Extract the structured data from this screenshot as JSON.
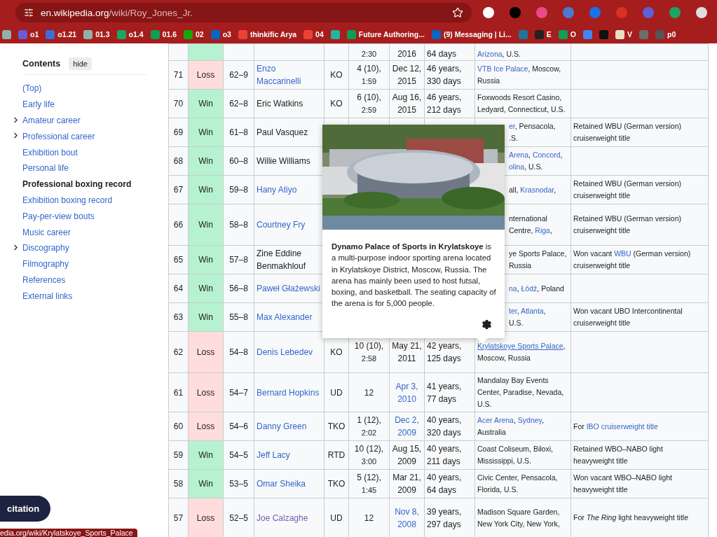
{
  "browser": {
    "url_host": "en.wikipedia.org",
    "url_path": "/wiki/Roy_Jones_Jr.",
    "bookmarks": [
      {
        "color": "#8fb3a8"
      },
      {
        "label": "o1",
        "color": "#6b5bd6"
      },
      {
        "label": "o1.21",
        "color": "#3a6fd8"
      },
      {
        "label": "01.3",
        "color": "#8fb3a8"
      },
      {
        "label": "o1.4",
        "color": "#1fa463"
      },
      {
        "label": "01.6",
        "color": "#0f9d58"
      },
      {
        "label": "02",
        "color": "#14a800"
      },
      {
        "label": "o3",
        "color": "#0a66c2"
      },
      {
        "label": "thinkific Arya",
        "color": "#ea4335"
      },
      {
        "label": "04",
        "color": "#ea4335"
      },
      {
        "color": "#27b3a0"
      },
      {
        "label": "Future Authoring...",
        "color": "#0f9d58"
      },
      {
        "label": "(9) Messaging | Li...",
        "color": "#0a66c2"
      },
      {
        "color": "#21759b"
      },
      {
        "label": "E",
        "color": "#222222"
      },
      {
        "label": "O",
        "color": "#0f9d58"
      },
      {
        "color": "#4285f4"
      },
      {
        "color": "#111111"
      },
      {
        "label": "V",
        "color": "#e8e0c0"
      },
      {
        "color": "#6d6d6d"
      },
      {
        "label": "p0",
        "color": "#555555"
      }
    ]
  },
  "contents": {
    "title": "Contents",
    "hide_button": "hide",
    "items": [
      {
        "label": "(Top)",
        "expandable": false,
        "selected": false
      },
      {
        "label": "Early life",
        "expandable": false,
        "selected": false
      },
      {
        "label": "Amateur career",
        "expandable": true,
        "selected": false
      },
      {
        "label": "Professional career",
        "expandable": true,
        "selected": false
      },
      {
        "label": "Exhibition bout",
        "expandable": false,
        "selected": false
      },
      {
        "label": "Personal life",
        "expandable": false,
        "selected": false
      },
      {
        "label": "Professional boxing record",
        "expandable": false,
        "selected": true
      },
      {
        "label": "Exhibition boxing record",
        "expandable": false,
        "selected": false
      },
      {
        "label": "Pay-per-view bouts",
        "expandable": false,
        "selected": false
      },
      {
        "label": "Music career",
        "expandable": false,
        "selected": false
      },
      {
        "label": "Discography",
        "expandable": true,
        "selected": false
      },
      {
        "label": "Filmography",
        "expandable": false,
        "selected": false
      },
      {
        "label": "References",
        "expandable": false,
        "selected": false
      },
      {
        "label": "External links",
        "expandable": false,
        "selected": false
      }
    ]
  },
  "table": {
    "rows": [
      {
        "result": {
          "kind": "win"
        },
        "round": {
          "time": "2:30"
        },
        "date": {
          "text": "2016",
          "kind": "text"
        },
        "age": "64 days",
        "location": [
          {
            "text": "Arizona",
            "kind": "link"
          },
          {
            "text": ", U.S.",
            "kind": "text"
          }
        ]
      },
      {
        "no": "71",
        "result": {
          "text": "Loss",
          "kind": "loss"
        },
        "record": "62–9",
        "opponent": {
          "text": "Enzo Maccarinelli",
          "kind": "link"
        },
        "type": "KO",
        "round": {
          "text": "4 (10),",
          "time": "1:59"
        },
        "date": {
          "text": "Dec 12, 2015",
          "kind": "text"
        },
        "age": "46 years, 330 days",
        "location": [
          {
            "text": "VTB Ice Palace",
            "kind": "link"
          },
          {
            "text": ", Moscow, Russia",
            "kind": "text"
          }
        ]
      },
      {
        "no": "70",
        "result": {
          "text": "Win",
          "kind": "win"
        },
        "record": "62–8",
        "opponent": {
          "text": "Eric Watkins",
          "kind": "text"
        },
        "type": "KO",
        "round": {
          "text": "6 (10),",
          "time": "2:59"
        },
        "date": {
          "text": "Aug 16, 2015",
          "kind": "text"
        },
        "age": "46 years, 212 days",
        "location": [
          {
            "text": "Foxwoods Resort Casino, Ledyard, Connecticut, U.S.",
            "kind": "text"
          }
        ]
      },
      {
        "no": "69",
        "result": {
          "text": "Win",
          "kind": "win"
        },
        "record": "61–8",
        "opponent": {
          "text": "Paul Vasquez",
          "kind": "text"
        },
        "location_fragments": [
          [
            {
              "text": "er",
              "kind": "link"
            },
            {
              "text": ", Pensacola,",
              "kind": "text"
            }
          ],
          [
            {
              "text": ".S.",
              "kind": "text"
            }
          ]
        ],
        "notes": [
          {
            "text": "Retained WBU (German version) cruiserweight title",
            "kind": "text"
          }
        ]
      },
      {
        "no": "68",
        "result": {
          "text": "Win",
          "kind": "win"
        },
        "record": "60–8",
        "opponent": {
          "text": "Willie Williams",
          "kind": "text"
        },
        "location_fragments": [
          [
            {
              "text": "Arena",
              "kind": "link"
            },
            {
              "text": ", ",
              "kind": "text"
            },
            {
              "text": "Concord",
              "kind": "link"
            },
            {
              "text": ",",
              "kind": "text"
            }
          ],
          [
            {
              "text": "olina",
              "kind": "link"
            },
            {
              "text": ", U.S.",
              "kind": "text"
            }
          ]
        ]
      },
      {
        "no": "67",
        "result": {
          "text": "Win",
          "kind": "win"
        },
        "record": "59–8",
        "opponent": {
          "text": "Hany Atiyo",
          "kind": "link"
        },
        "location_fragments": [
          [
            {
              "text": "all, ",
              "kind": "text"
            },
            {
              "text": "Krasnodar",
              "kind": "link"
            },
            {
              "text": ",",
              "kind": "text"
            }
          ]
        ],
        "notes": [
          {
            "text": "Retained WBU (German version) cruiserweight title",
            "kind": "text"
          }
        ]
      },
      {
        "no": "66",
        "result": {
          "text": "Win",
          "kind": "win"
        },
        "record": "58–8",
        "opponent": {
          "text": "Courtney Fry",
          "kind": "link"
        },
        "location_fragments": [
          [
            {
              "text": "nternational",
              "kind": "text"
            }
          ],
          [
            {
              "text": "Centre, ",
              "kind": "text"
            },
            {
              "text": "Riga",
              "kind": "link"
            },
            {
              "text": ",",
              "kind": "text"
            }
          ]
        ],
        "notes": [
          {
            "text": "Retained WBU (German version) cruiserweight title",
            "kind": "text"
          }
        ]
      },
      {
        "no": "65",
        "result": {
          "text": "Win",
          "kind": "win"
        },
        "record": "57–8",
        "opponent": {
          "text": "Zine Eddine Benmakhlouf",
          "kind": "text"
        },
        "location_fragments": [
          [
            {
              "text": "ye Sports Palace,",
              "kind": "text"
            }
          ],
          [
            {
              "text": "Russia",
              "kind": "text"
            }
          ]
        ],
        "notes": [
          {
            "text": "Won vacant ",
            "kind": "text"
          },
          {
            "text": "WBU",
            "kind": "link"
          },
          {
            "text": " (German version) cruiserweight title",
            "kind": "text"
          }
        ]
      },
      {
        "no": "64",
        "result": {
          "text": "Win",
          "kind": "win"
        },
        "record": "56–8",
        "opponent": {
          "text": "Paweł Głażewski",
          "kind": "link"
        },
        "location_fragments": [
          [
            {
              "text": "na",
              "kind": "link"
            },
            {
              "text": ", ",
              "kind": "text"
            },
            {
              "text": "Łódź",
              "kind": "link"
            },
            {
              "text": ", Poland",
              "kind": "text"
            }
          ]
        ]
      },
      {
        "no": "63",
        "result": {
          "text": "Win",
          "kind": "win"
        },
        "record": "55–8",
        "opponent": {
          "text": "Max Alexander",
          "kind": "link"
        },
        "location_fragments": [
          [
            {
              "text": "ter",
              "kind": "link"
            },
            {
              "text": ", ",
              "kind": "text"
            },
            {
              "text": "Atlanta",
              "kind": "link"
            },
            {
              "text": ",",
              "kind": "text"
            }
          ],
          [
            {
              "text": "U.S.",
              "kind": "text"
            }
          ]
        ],
        "notes": [
          {
            "text": "Won vacant UBO Intercontinental cruiserweight title",
            "kind": "text"
          }
        ]
      },
      {
        "no": "62",
        "result": {
          "text": "Loss",
          "kind": "loss"
        },
        "record": "54–8",
        "opponent": {
          "text": "Denis Lebedev",
          "kind": "link"
        },
        "type": "KO",
        "round": {
          "text": "10 (10),",
          "time": "2:58"
        },
        "date": {
          "text": "May 21, 2011",
          "kind": "text"
        },
        "age": "42 years, 125 days",
        "location": [
          {
            "text": "Krylatskoye Sports Palace",
            "kind": "hovered_link"
          },
          {
            "text": ", Moscow, Russia",
            "kind": "text"
          }
        ]
      },
      {
        "no": "61",
        "result": {
          "text": "Loss",
          "kind": "loss"
        },
        "record": "54–7",
        "opponent": {
          "text": "Bernard Hopkins",
          "kind": "link"
        },
        "type": "UD",
        "round": {
          "text": "12"
        },
        "date": {
          "text": "Apr 3, 2010",
          "kind": "link"
        },
        "age": "41 years, 77 days",
        "location": [
          {
            "text": "Mandalay Bay Events Center, Paradise, Nevada, U.S.",
            "kind": "text"
          }
        ]
      },
      {
        "no": "60",
        "result": {
          "text": "Loss",
          "kind": "loss"
        },
        "record": "54–6",
        "opponent": {
          "text": "Danny Green",
          "kind": "link"
        },
        "type": "TKO",
        "round": {
          "text": "1 (12),",
          "time": "2:02"
        },
        "date": {
          "text": "Dec 2, 2009",
          "kind": "link"
        },
        "age": "40 years, 320 days",
        "location": [
          {
            "text": "Acer Arena",
            "kind": "link"
          },
          {
            "text": ", ",
            "kind": "text"
          },
          {
            "text": "Sydney",
            "kind": "link"
          },
          {
            "text": ", Australia",
            "kind": "text"
          }
        ],
        "notes": [
          {
            "text": "For ",
            "kind": "text"
          },
          {
            "text": "IBO cruiserweight title",
            "kind": "link"
          }
        ]
      },
      {
        "no": "59",
        "result": {
          "text": "Win",
          "kind": "win"
        },
        "record": "54–5",
        "opponent": {
          "text": "Jeff Lacy",
          "kind": "link"
        },
        "type": "RTD",
        "round": {
          "text": "10 (12),",
          "time": "3:00"
        },
        "date": {
          "text": "Aug 15, 2009",
          "kind": "text"
        },
        "age": "40 years, 211 days",
        "location": [
          {
            "text": "Coast Coliseum, Biloxi, Mississippi, U.S.",
            "kind": "text"
          }
        ],
        "notes": [
          {
            "text": "Retained WBO–NABO light heavyweight title",
            "kind": "text"
          }
        ]
      },
      {
        "no": "58",
        "result": {
          "text": "Win",
          "kind": "win"
        },
        "record": "53–5",
        "opponent": {
          "text": "Omar Sheika",
          "kind": "link"
        },
        "type": "TKO",
        "round": {
          "text": "5 (12),",
          "time": "1:45"
        },
        "date": {
          "text": "Mar 21, 2009",
          "kind": "text"
        },
        "age": "40 years, 64 days",
        "location": [
          {
            "text": "Civic Center, Pensacola, Florida, U.S.",
            "kind": "text"
          }
        ],
        "notes": [
          {
            "text": "Won vacant WBO–NABO light heavyweight title",
            "kind": "text"
          }
        ]
      },
      {
        "no": "57",
        "result": {
          "text": "Loss",
          "kind": "loss"
        },
        "record": "52–5",
        "opponent": {
          "text": "Joe Calzaghe",
          "kind": "visited_link"
        },
        "type": "UD",
        "round": {
          "text": "12"
        },
        "date": {
          "text": "Nov 8, 2008",
          "kind": "link"
        },
        "age": "39 years, 297 days",
        "location": [
          {
            "text": "Madison Square Garden, New York City, New York,",
            "kind": "text"
          }
        ],
        "notes": [
          {
            "text": "For ",
            "kind": "text"
          },
          {
            "text": "The Ring",
            "kind": "italic"
          },
          {
            "text": " light heavyweight title",
            "kind": "text"
          }
        ]
      }
    ]
  },
  "preview": {
    "text": "**Dynamo Palace of Sports in Krylatskoye** is a multi-purpose indoor sporting arena located in Krylatskoye District, Moscow, Russia. The arena has mainly been used to host futsal, boxing, and basketball. The seating capacity of the arena is for 5,000 people."
  },
  "citation_button": "citation",
  "status_url": "edia.org/wiki/Krylatskoye_Sports_Palace"
}
